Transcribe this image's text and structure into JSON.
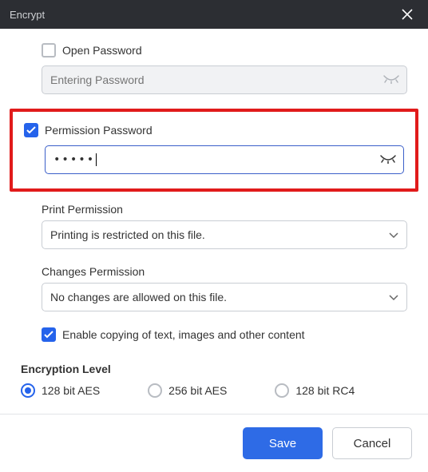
{
  "title": "Encrypt",
  "open_password": {
    "label": "Open Password",
    "checked": false,
    "placeholder": "Entering Password",
    "value": ""
  },
  "permission_password": {
    "label": "Permission Password",
    "checked": true,
    "masked_value": "•••••"
  },
  "print_permission": {
    "label": "Print Permission",
    "value": "Printing is restricted on this file."
  },
  "changes_permission": {
    "label": "Changes Permission",
    "value": "No changes are allowed on this file."
  },
  "copy_option": {
    "label": "Enable copying of text, images and other content",
    "checked": true
  },
  "encryption": {
    "label": "Encryption Level",
    "options": [
      {
        "label": "128 bit AES",
        "selected": true
      },
      {
        "label": "256 bit AES",
        "selected": false
      },
      {
        "label": "128 bit RC4",
        "selected": false
      }
    ]
  },
  "buttons": {
    "save": "Save",
    "cancel": "Cancel"
  }
}
